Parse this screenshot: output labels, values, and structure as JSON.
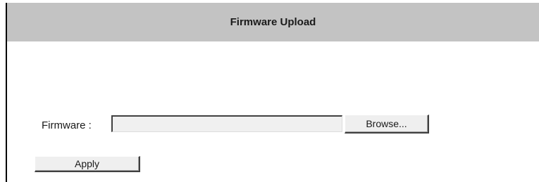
{
  "header": {
    "title": "Firmware Upload"
  },
  "form": {
    "firmware_label": "Firmware :",
    "firmware_value": "",
    "browse_label": "Browse...",
    "apply_label": "Apply"
  }
}
